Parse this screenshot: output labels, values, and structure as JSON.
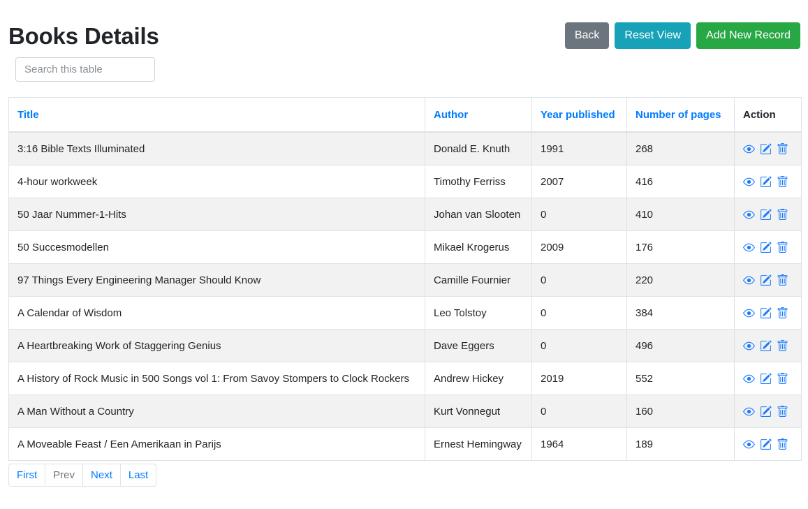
{
  "header": {
    "title": "Books Details"
  },
  "search": {
    "placeholder": "Search this table",
    "value": ""
  },
  "toolbar": {
    "back_label": "Back",
    "reset_label": "Reset View",
    "add_label": "Add New Record",
    "back_color": "#6c757d",
    "reset_color": "#17a2b8",
    "add_color": "#28a745"
  },
  "table": {
    "columns": [
      {
        "label": "Title",
        "sortable": true
      },
      {
        "label": "Author",
        "sortable": true
      },
      {
        "label": "Year published",
        "sortable": true
      },
      {
        "label": "Number of pages",
        "sortable": true
      },
      {
        "label": "Action",
        "sortable": false
      }
    ],
    "row_actions": [
      {
        "name": "view-icon",
        "title": "View"
      },
      {
        "name": "edit-icon",
        "title": "Edit"
      },
      {
        "name": "delete-icon",
        "title": "Delete"
      }
    ],
    "action_icon_color": "#1a7bff",
    "rows": [
      {
        "title": "3:16 Bible Texts Illuminated",
        "author": "Donald E. Knuth",
        "year": "1991",
        "pages": "268"
      },
      {
        "title": "4-hour workweek",
        "author": "Timothy Ferriss",
        "year": "2007",
        "pages": "416"
      },
      {
        "title": "50 Jaar Nummer-1-Hits",
        "author": "Johan van Slooten",
        "year": "0",
        "pages": "410"
      },
      {
        "title": "50 Succesmodellen",
        "author": "Mikael Krogerus",
        "year": "2009",
        "pages": "176"
      },
      {
        "title": "97 Things Every Engineering Manager Should Know",
        "author": "Camille Fournier",
        "year": "0",
        "pages": "220"
      },
      {
        "title": "A Calendar of Wisdom",
        "author": "Leo Tolstoy",
        "year": "0",
        "pages": "384"
      },
      {
        "title": "A Heartbreaking Work of Staggering Genius",
        "author": "Dave Eggers",
        "year": "0",
        "pages": "496"
      },
      {
        "title": "A History of Rock Music in 500 Songs vol 1: From Savoy Stompers to Clock Rockers",
        "author": "Andrew Hickey",
        "year": "2019",
        "pages": "552"
      },
      {
        "title": "A Man Without a Country",
        "author": "Kurt Vonnegut",
        "year": "0",
        "pages": "160"
      },
      {
        "title": "A Moveable Feast / Een Amerikaan in Parijs",
        "author": "Ernest Hemingway",
        "year": "1964",
        "pages": "189"
      }
    ]
  },
  "pagination": {
    "buttons": [
      {
        "label": "First",
        "disabled": false
      },
      {
        "label": "Prev",
        "disabled": true
      },
      {
        "label": "Next",
        "disabled": false
      },
      {
        "label": "Last",
        "disabled": false
      }
    ]
  }
}
